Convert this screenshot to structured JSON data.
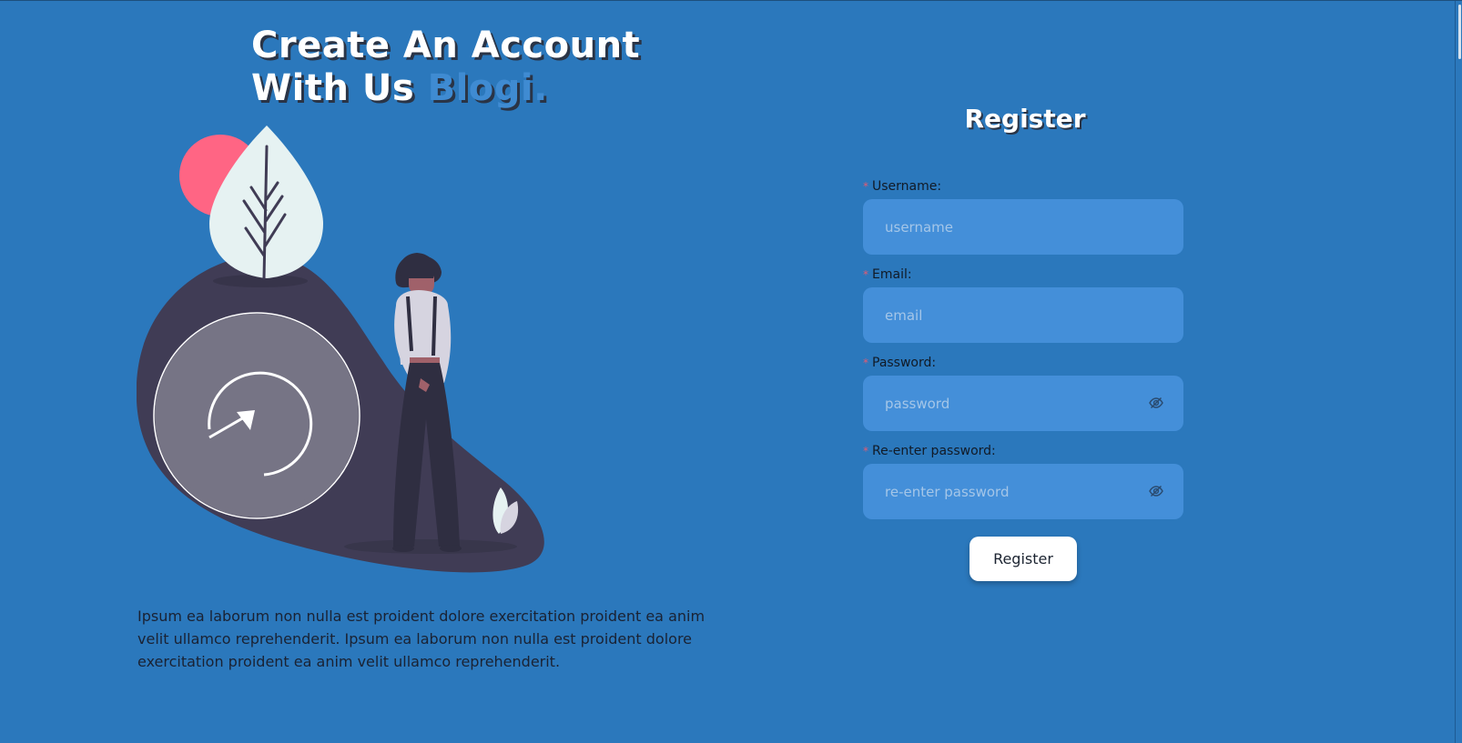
{
  "hero": {
    "title_line1": "Create An Account",
    "title_line2_prefix": "With Us",
    "brand": "Blogi.",
    "description": "Ipsum ea laborum non nulla est proident dolore exercitation proident ea anim velit ullamco reprehenderit. Ipsum ea laborum non nulla est proident dolore exercitation proident ea anim velit ullamco reprehenderit."
  },
  "form": {
    "title": "Register",
    "required_marker": "*",
    "fields": [
      {
        "label": "Username:",
        "placeholder": "username",
        "type": "text"
      },
      {
        "label": "Email:",
        "placeholder": "email",
        "type": "email"
      },
      {
        "label": "Password:",
        "placeholder": "password",
        "type": "password"
      },
      {
        "label": "Re-enter password:",
        "placeholder": "re-enter password",
        "type": "password"
      }
    ],
    "submit_label": "Register"
  },
  "icons": {
    "password_toggle": "eye-slash-icon",
    "illustration": "woman-with-leaf-and-circle-illustration"
  },
  "colors": {
    "background": "#2b78bc",
    "input_bg": "#448fd9",
    "brand": "#3f8bd2",
    "required": "#e35b73",
    "text_dark": "#1a2233"
  }
}
